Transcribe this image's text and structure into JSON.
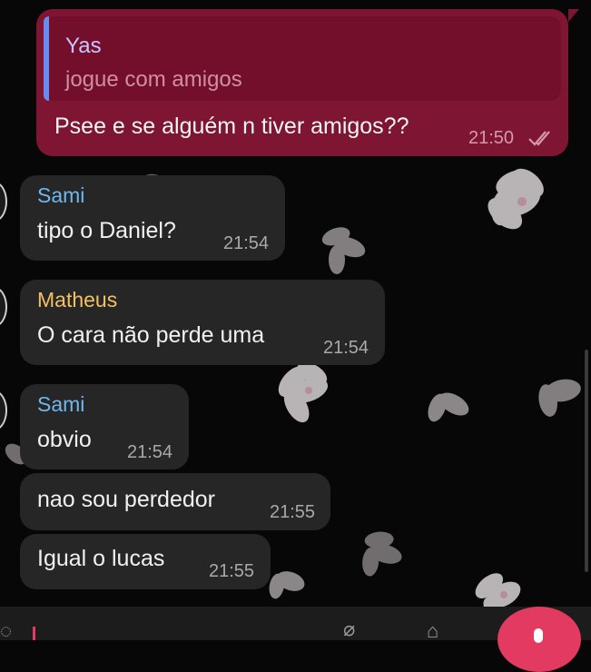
{
  "chat": {
    "outgoing": {
      "reply_to": {
        "name": "Yas",
        "text": "jogue com amigos"
      },
      "text": "Psee e se alguém n tiver amigos??",
      "time": "21:50",
      "status_icon": "double-check-icon"
    },
    "incoming": [
      {
        "sender": "Sami",
        "sender_color": "#6fb7ee",
        "text": "tipo o Daniel?",
        "time": "21:54"
      },
      {
        "sender": "Matheus",
        "sender_color": "#f3c064",
        "text": "O cara não perde uma",
        "time": "21:54"
      },
      {
        "sender": "Sami",
        "sender_color": "#6fb7ee",
        "text": "obvio",
        "time": "21:54"
      },
      {
        "text": "nao sou perdedor",
        "time": "21:55"
      },
      {
        "text": "Igual o lucas",
        "time": "21:55"
      }
    ]
  },
  "colors": {
    "outgoing_bubble": "#7e1532",
    "incoming_bubble": "#262626",
    "accent": "#e23a60",
    "reply_bar": "#6a8cf0"
  },
  "input_bar": {
    "icons": [
      "emoji-icon",
      "attach-icon",
      "camera-icon",
      "mic-icon"
    ]
  }
}
